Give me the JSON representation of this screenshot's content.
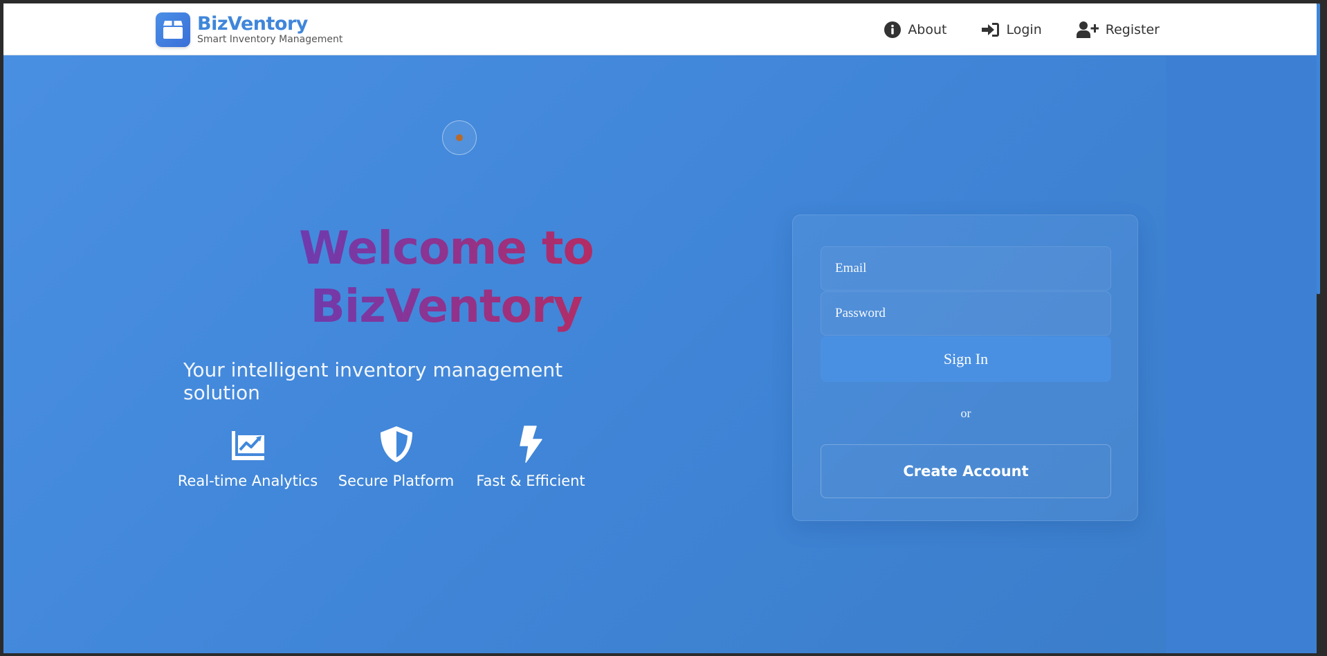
{
  "brand": {
    "name": "BizVentory",
    "tagline": "Smart Inventory Management"
  },
  "nav": {
    "items": [
      {
        "label": "About",
        "icon": "info-circle-icon"
      },
      {
        "label": "Login",
        "icon": "sign-in-icon"
      },
      {
        "label": "Register",
        "icon": "user-plus-icon"
      }
    ]
  },
  "hero": {
    "title_line1": "Welcome to",
    "title_line2": "BizVentory",
    "subtitle": "Your intelligent inventory management solution",
    "features": [
      {
        "label": "Real-time Analytics",
        "icon": "chart-line-icon"
      },
      {
        "label": "Secure Platform",
        "icon": "shield-icon"
      },
      {
        "label": "Fast & Efficient",
        "icon": "bolt-icon"
      }
    ]
  },
  "login": {
    "email_placeholder": "Email",
    "password_placeholder": "Password",
    "signin_label": "Sign In",
    "or_text": "or",
    "create_account_label": "Create Account"
  },
  "colors": {
    "brand": "#3f86da",
    "background": "#4a90e2",
    "title_gradient_start": "#5b3fc0",
    "title_gradient_end": "#c9284a"
  }
}
